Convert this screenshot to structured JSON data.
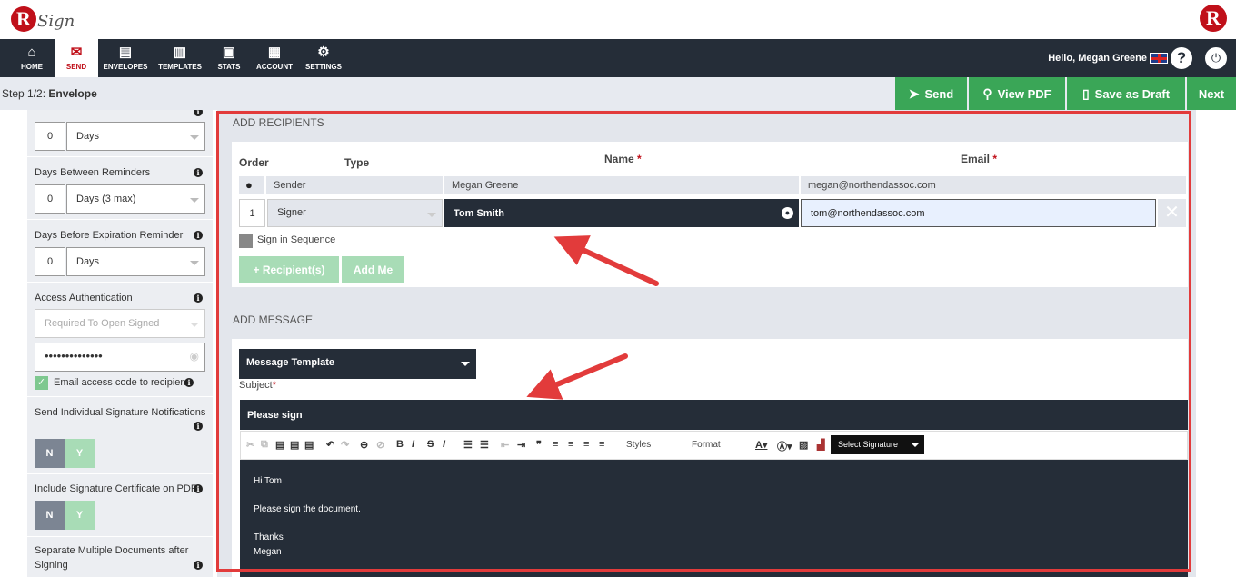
{
  "brand": {
    "logo_letter": "R",
    "logo_word": "Sign",
    "accent": "#c0101a"
  },
  "nav": {
    "items": [
      {
        "icon": "home-icon",
        "label": "HOME"
      },
      {
        "icon": "envelope-icon",
        "label": "SEND"
      },
      {
        "icon": "inbox-icon",
        "label": "ENVELOPES"
      },
      {
        "icon": "template-icon",
        "label": "TEMPLATES"
      },
      {
        "icon": "briefcase-icon",
        "label": "STATS"
      },
      {
        "icon": "account-icon",
        "label": "ACCOUNT"
      },
      {
        "icon": "gear-icon",
        "label": "SETTINGS"
      }
    ],
    "greeting": "Hello, Megan Greene"
  },
  "step": {
    "prefix": "Step 1/2:",
    "name": "Envelope"
  },
  "actions": {
    "send": "Send",
    "view_pdf": "View PDF",
    "save_draft": "Save as Draft",
    "next": "Next"
  },
  "sidebar": {
    "first_reminder": {
      "value": "0",
      "unit": "Days"
    },
    "between_reminders": {
      "label": "Days Between Reminders",
      "value": "0",
      "unit": "Days (3 max)"
    },
    "expiration_reminder": {
      "label": "Days Before Expiration Reminder",
      "value": "0",
      "unit": "Days"
    },
    "access_auth": {
      "label": "Access Authentication",
      "select": "Required To Open Signed",
      "password": "••••••••••••••",
      "email_code": "Email access code to recipient"
    },
    "individual_notifications": {
      "label": "Send Individual Signature Notifications",
      "n": "N",
      "y": "Y"
    },
    "include_certificate": {
      "label": "Include Signature Certificate on PDF",
      "n": "N",
      "y": "Y"
    },
    "separate_docs": {
      "label1": "Separate Multiple Documents after",
      "label2": "Signing"
    }
  },
  "recipients": {
    "title": "ADD RECIPIENTS",
    "headers": {
      "order": "Order",
      "type": "Type",
      "name": "Name",
      "email": "Email",
      "required": "*"
    },
    "sender": {
      "type": "Sender",
      "name": "Megan Greene",
      "email": "megan@northendassoc.com"
    },
    "signer": {
      "order": "1",
      "type": "Signer",
      "name": "Tom Smith",
      "email": "tom@northendassoc.com"
    },
    "sign_in_sequence": "Sign in Sequence",
    "add_recipient": "+ Recipient(s)",
    "add_me": "Add Me"
  },
  "message": {
    "title": "ADD MESSAGE",
    "template": "Message Template",
    "subject_label": "Subject",
    "subject": "Please sign",
    "toolbar": {
      "styles": "Styles",
      "format": "Format",
      "select_signature": "Select Signature"
    },
    "body": [
      "Hi Tom",
      "Please sign the document.",
      "Thanks",
      "Megan"
    ]
  }
}
